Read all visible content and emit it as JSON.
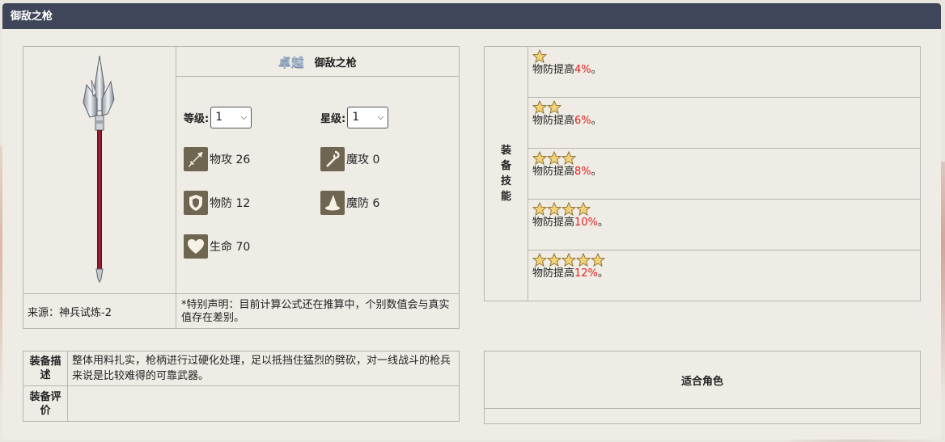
{
  "title": "御敌之枪",
  "equipment": {
    "rarity_badge": "卓越",
    "name": "御敌之枪",
    "level_label": "等级:",
    "level_value": "1",
    "star_label": "星级:",
    "star_value": "1",
    "stats": [
      {
        "icon": "sword-icon",
        "label": "物攻 26"
      },
      {
        "icon": "staff-icon",
        "label": "魔攻 0"
      },
      {
        "icon": "shield-icon",
        "label": "物防 12"
      },
      {
        "icon": "wizard-hat-icon",
        "label": "魔防 6"
      },
      {
        "icon": "heart-icon",
        "label": "生命 70"
      }
    ],
    "source": "来源：神兵试炼-2",
    "note": "*特别声明：目前计算公式还在推算中，个别数值会与真实值存在差别。"
  },
  "skills": {
    "label": "装备技能",
    "rows": [
      {
        "stars": 1,
        "prefix": "物防提高",
        "value": "4%",
        "suffix": "。"
      },
      {
        "stars": 2,
        "prefix": "物防提高",
        "value": "6%",
        "suffix": "。"
      },
      {
        "stars": 3,
        "prefix": "物防提高",
        "value": "8%",
        "suffix": "。"
      },
      {
        "stars": 4,
        "prefix": "物防提高",
        "value": "10%",
        "suffix": "。"
      },
      {
        "stars": 5,
        "prefix": "物防提高",
        "value": "12%",
        "suffix": "。"
      }
    ]
  },
  "description": {
    "desc_label": "装备描述",
    "desc_text": "整体用料扎实，枪柄进行过硬化处理，足以抵挡住猛烈的劈砍，对一线战斗的枪兵来说是比较难得的可靠武器。",
    "eval_label": "装备评价",
    "eval_text": ""
  },
  "roles": {
    "label": "适合角色"
  },
  "colors": {
    "title_bar": "#3f4659",
    "highlight": "#e02020",
    "icon_bg": "#6f6651",
    "star_fill": "#f3d27a"
  }
}
